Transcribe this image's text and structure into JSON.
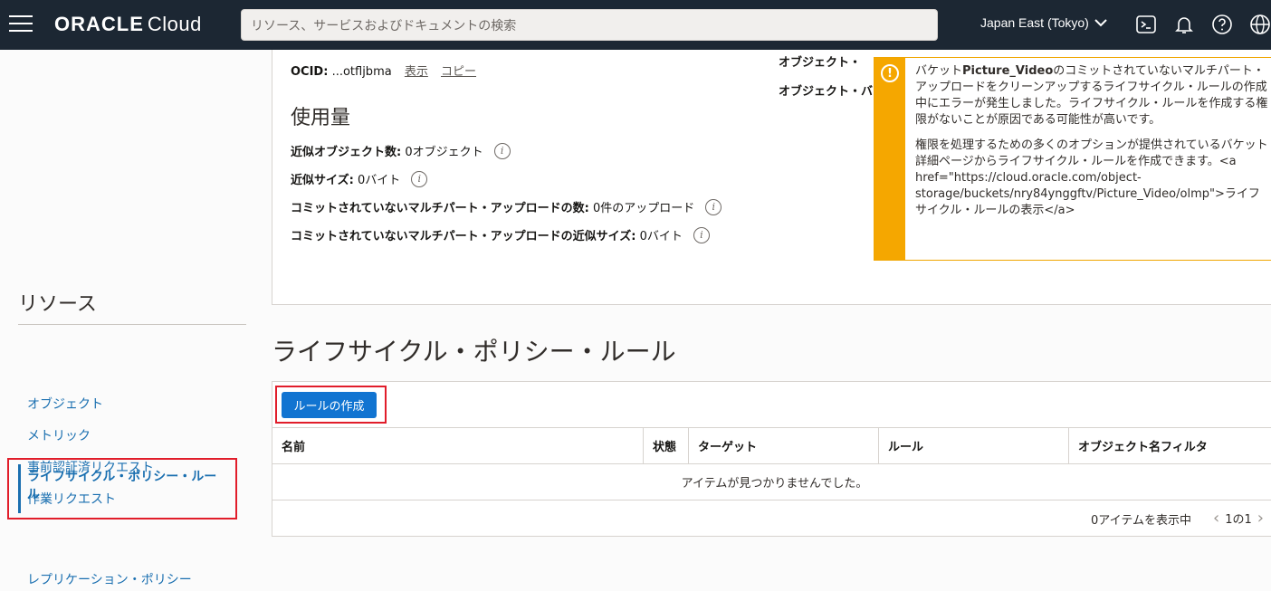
{
  "header": {
    "logo_brand": "ORACLE",
    "logo_product": "Cloud",
    "search_placeholder": "リソース、サービスおよびドキュメントの検索",
    "region": "Japan East (Tokyo)"
  },
  "details": {
    "ocid_label": "OCID:",
    "ocid_value": "...otfljbma",
    "ocid_show": "表示",
    "ocid_copy": "コピー",
    "obj_label_1": "オブジェクト・",
    "obj_label_2": "オブジェクト・バ",
    "usage_title": "使用量",
    "usage": [
      {
        "label": "近似オブジェクト数:",
        "value": "0オブジェクト"
      },
      {
        "label": "近似サイズ:",
        "value": "0バイト"
      },
      {
        "label": "コミットされていないマルチパート・アップロードの数:",
        "value": "0件のアップロード"
      },
      {
        "label": "コミットされていないマルチパート・アップロードの近似サイズ:",
        "value": "0バイト"
      }
    ]
  },
  "warning": {
    "p1_before": "バケット",
    "p1_bucket": "Picture_Video",
    "p1_after": "のコミットされていないマルチパート・アップロードをクリーンアップするライフサイクル・ルールの作成中にエラーが発生しました。ライフサイクル・ルールを作成する権限がないことが原因である可能性が高いです。",
    "p2": "権限を処理するための多くのオプションが提供されているバケット詳細ページからライフサイクル・ルールを作成できます。<a href=\"https://cloud.oracle.com/object-storage/buckets/nry84ynggftv/Picture_Video/olmp\">ライフサイクル・ルールの表示</a>"
  },
  "sidebar": {
    "title": "リソース",
    "items": [
      "オブジェクト",
      "メトリック",
      "事前認証済リクエスト",
      "作業リクエスト"
    ],
    "active": "ライフサイクル・ポリシー・ルール",
    "after": "レプリケーション・ポリシー"
  },
  "lifecycle": {
    "title": "ライフサイクル・ポリシー・ルール",
    "create_button": "ルールの作成",
    "columns": [
      "名前",
      "状態",
      "ターゲット",
      "ルール",
      "オブジェクト名フィルタ"
    ],
    "empty_message": "アイテムが見つかりませんでした。",
    "count_text": "0アイテムを表示中",
    "page_text": "1の1"
  }
}
